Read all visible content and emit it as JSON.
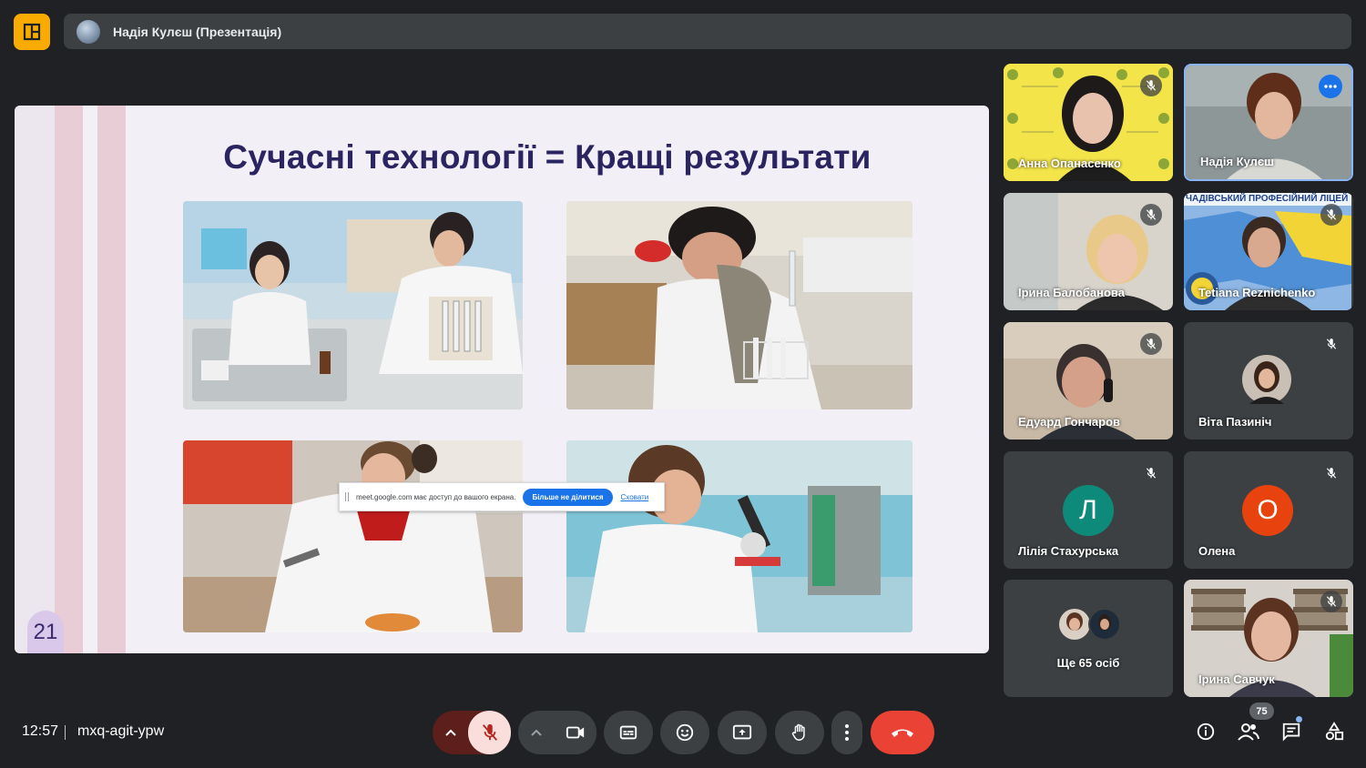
{
  "presenter": {
    "name": "Надія Кулєш (Презентація)"
  },
  "slide": {
    "title": "Сучасні технології = Кращі результати",
    "number": "21"
  },
  "share_notice": {
    "text": "meet.google.com має доступ до вашого екрана.",
    "stop_label": "Більше не ділитися",
    "hide_label": "Сховати"
  },
  "participants": [
    {
      "name": "Анна Опанасенко"
    },
    {
      "name": "Надія Кулєш"
    },
    {
      "name": "Ірина Балобанова"
    },
    {
      "name": "Tetiana Reznichenko"
    },
    {
      "name": "Едуард Гончаров"
    },
    {
      "name": "Віта Пазиніч"
    },
    {
      "name": "Лілія Стахурська",
      "initial": "Л",
      "color": "#0e8a7a"
    },
    {
      "name": "Олена",
      "initial": "О",
      "color": "#e8430f"
    },
    {
      "name": "Ще 65 осіб"
    },
    {
      "name": "Ірина Савчук"
    }
  ],
  "tile_banner": "ЧАДІВСЬКИЙ ПРОФЕСІЙНИЙ ЛІЦЕЙ",
  "footer": {
    "time": "12:57",
    "meeting_code": "mxq-agit-ypw",
    "people_count": "75"
  },
  "colors": {
    "accent": "#8ab4f8",
    "end_call": "#ea4335",
    "mic_off_bg": "#f9dedc",
    "mic_off_icon": "#b3261e",
    "logo": "#f9ab00",
    "title": "#2a2461"
  },
  "icons": [
    "mic-off-icon",
    "camera-icon",
    "captions-icon",
    "emoji-icon",
    "present-icon",
    "hand-icon",
    "more-vert-icon",
    "call-end-icon",
    "info-icon",
    "people-icon",
    "chat-icon",
    "activities-icon"
  ]
}
